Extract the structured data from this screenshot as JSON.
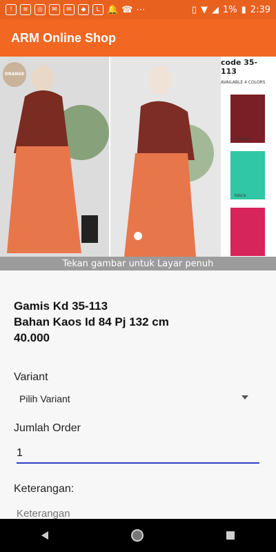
{
  "status": {
    "battery_percent": "1%",
    "time": "2:39"
  },
  "app": {
    "title": "ARM Online Shop"
  },
  "banner": {
    "badge": "ORANGE",
    "code": "code 35-113",
    "colors_title": "AVAILABLE 4 COLORS",
    "color_labels": [
      "maroon",
      "tosca"
    ],
    "caption": "Tekan gambar untuk Layar penuh"
  },
  "product": {
    "name": "Gamis Kd 35-113",
    "description": "Bahan Kaos Id 84 Pj 132 cm",
    "price": "40.000"
  },
  "form": {
    "variant_label": "Variant",
    "variant_value": "Pilih Variant",
    "quantity_label": "Jumlah Order",
    "quantity_value": "1",
    "note_label": "Keterangan:",
    "note_placeholder": "Keterangan"
  },
  "colors": {
    "statusbar": "#e9611f",
    "appbar": "#f26722",
    "input_underline": "#2f42c7"
  }
}
